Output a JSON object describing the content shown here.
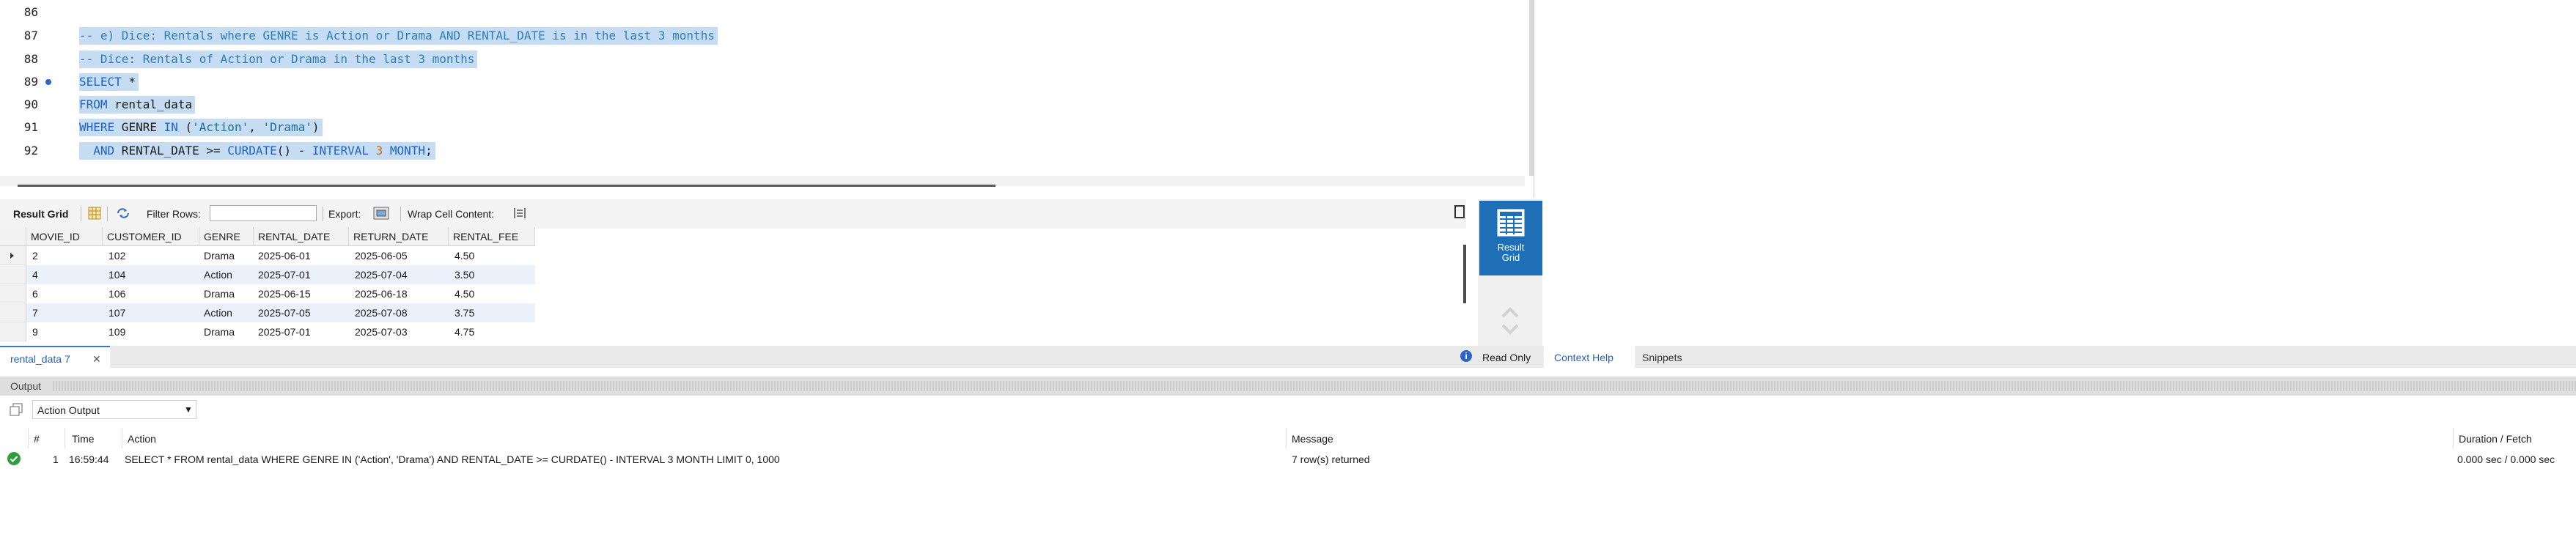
{
  "editor": {
    "lines": [
      {
        "num": "86",
        "text": ""
      },
      {
        "num": "87",
        "text": "-- e) Dice: Rentals where GENRE is Action or Drama AND RENTAL_DATE is in the last 3 months"
      },
      {
        "num": "88",
        "text": "-- Dice: Rentals of Action or Drama in the last 3 months"
      },
      {
        "num": "89",
        "tokens": [
          "SELECT",
          " *"
        ]
      },
      {
        "num": "90",
        "tokens": [
          "FROM",
          " rental_data"
        ]
      },
      {
        "num": "91",
        "tokens": [
          "WHERE",
          " GENRE ",
          "IN",
          " (",
          "'Action'",
          ", ",
          "'Drama'",
          ")"
        ]
      },
      {
        "num": "92",
        "tokens": [
          "  AND",
          " RENTAL_DATE >= ",
          "CURDATE",
          "() - ",
          "INTERVAL",
          " ",
          "3",
          " ",
          "MONTH",
          ";"
        ]
      }
    ]
  },
  "result_toolbar": {
    "result_grid": "Result Grid",
    "filter_rows": "Filter Rows:",
    "export": "Export:",
    "wrap_cell": "Wrap Cell Content:"
  },
  "grid": {
    "columns": [
      "MOVIE_ID",
      "CUSTOMER_ID",
      "GENRE",
      "RENTAL_DATE",
      "RETURN_DATE",
      "RENTAL_FEE"
    ],
    "rows": [
      [
        "2",
        "102",
        "Drama",
        "2025-06-01",
        "2025-06-05",
        "4.50"
      ],
      [
        "4",
        "104",
        "Action",
        "2025-07-01",
        "2025-07-04",
        "3.50"
      ],
      [
        "6",
        "106",
        "Drama",
        "2025-06-15",
        "2025-06-18",
        "4.50"
      ],
      [
        "7",
        "107",
        "Action",
        "2025-07-05",
        "2025-07-08",
        "3.75"
      ],
      [
        "9",
        "109",
        "Drama",
        "2025-07-01",
        "2025-07-03",
        "4.75"
      ]
    ]
  },
  "side_panel": {
    "result_grid_line1": "Result",
    "result_grid_line2": "Grid"
  },
  "tabs": {
    "result_tab": "rental_data 7",
    "read_only": "Read Only",
    "context_help": "Context Help",
    "snippets": "Snippets"
  },
  "output": {
    "title": "Output",
    "selector": "Action Output",
    "headers": {
      "num": "#",
      "time": "Time",
      "action": "Action",
      "message": "Message",
      "duration": "Duration / Fetch"
    },
    "row": {
      "num": "1",
      "time": "16:59:44",
      "action": "SELECT * FROM rental_data WHERE GENRE IN ('Action', 'Drama')   AND RENTAL_DATE >= CURDATE() - INTERVAL 3 MONTH LIMIT 0, 1000",
      "message": "7 row(s) returned",
      "duration": "0.000 sec / 0.000 sec"
    }
  }
}
